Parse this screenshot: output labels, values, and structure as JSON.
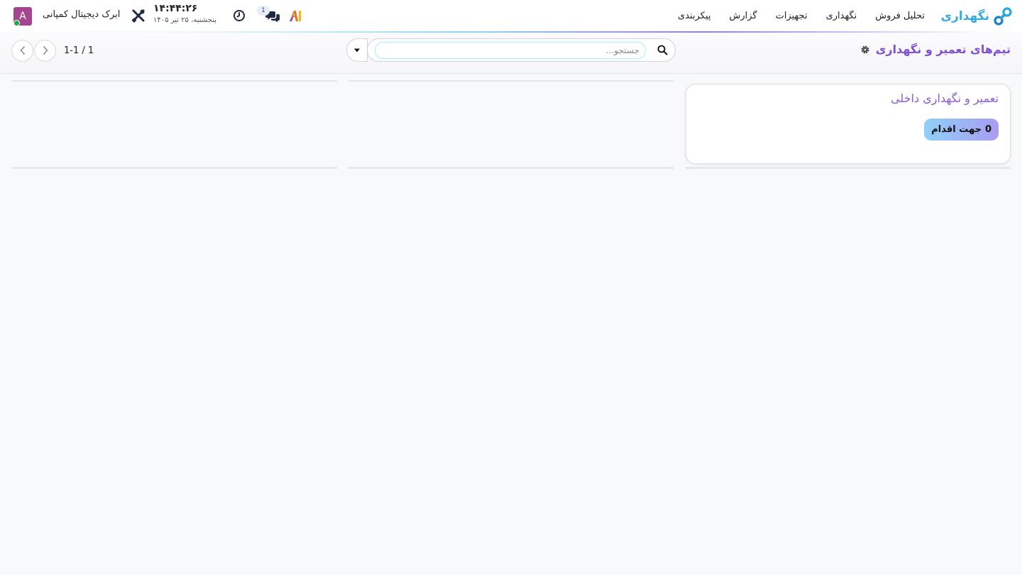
{
  "navbar": {
    "brand_name": "نگهداری",
    "menu": [
      {
        "label": "تحلیل فروش"
      },
      {
        "label": "نگهداری"
      },
      {
        "label": "تجهیزات"
      },
      {
        "label": "گزارش"
      },
      {
        "label": "پیکربندی"
      }
    ],
    "chat_badge": "1",
    "time": "۱۴:۴۴:۲۶",
    "date": "پنجشنبه، ۲۵ تیر ۱۴۰۵",
    "company": "ابرک دیجیتال کمپانی",
    "avatar_letter": "A",
    "accent_color": "#35a9e0",
    "avatar_color": "#a3468d",
    "icons": {
      "brand": "maintenance-logo-icon",
      "ai": "ai-icon",
      "chat": "chat-icon",
      "activity": "clock-icon",
      "debug": "tools-icon"
    }
  },
  "control_panel": {
    "title": "تیم‌های تعمیر و نگهداری",
    "title_color": "#7c4fd6",
    "search_placeholder": "جستجو...",
    "pager_value": "1-1 / 1"
  },
  "kanban": {
    "cards": [
      {
        "title": "تعمیر و نگهداری داخلی",
        "action_count": "0",
        "action_label": "جهت اقدام"
      }
    ]
  }
}
